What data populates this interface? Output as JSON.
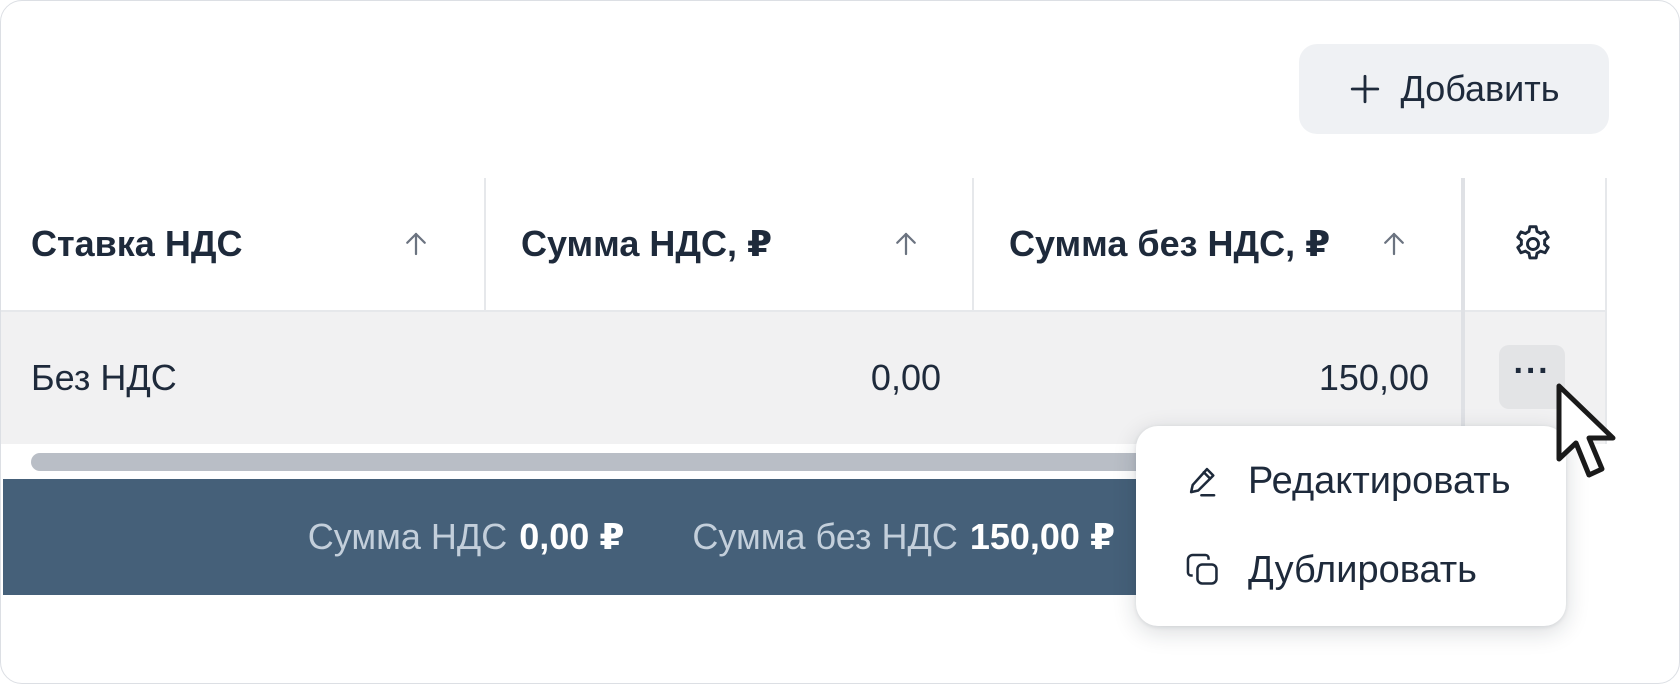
{
  "toolbar": {
    "add_label": "Добавить",
    "add_icon": "plus-icon"
  },
  "table": {
    "columns": [
      {
        "label": "Ставка НДС",
        "sort_icon": "arrow-up-icon"
      },
      {
        "label": "Сумма НДС, ₽",
        "sort_icon": "arrow-up-icon"
      },
      {
        "label": "Сумма без НДС, ₽",
        "sort_icon": "arrow-up-icon"
      }
    ],
    "settings_icon": "gear-icon",
    "rows": [
      {
        "rate": "Без НДС",
        "vat_sum": "0,00",
        "sum_without_vat": "150,00",
        "actions_label": "···"
      }
    ]
  },
  "footer": {
    "vat_label": "Сумма НДС",
    "vat_value": "0,00 ₽",
    "net_label": "Сумма без НДС",
    "net_value": "150,00 ₽"
  },
  "context_menu": {
    "items": [
      {
        "label": "Редактировать",
        "icon": "pen-icon"
      },
      {
        "label": "Дублировать",
        "icon": "duplicate-icon"
      }
    ]
  },
  "colors": {
    "text": "#1e2a3b",
    "footer_bg": "#456079",
    "row_bg": "#f1f1f2",
    "button_bg": "#eff1f4"
  }
}
